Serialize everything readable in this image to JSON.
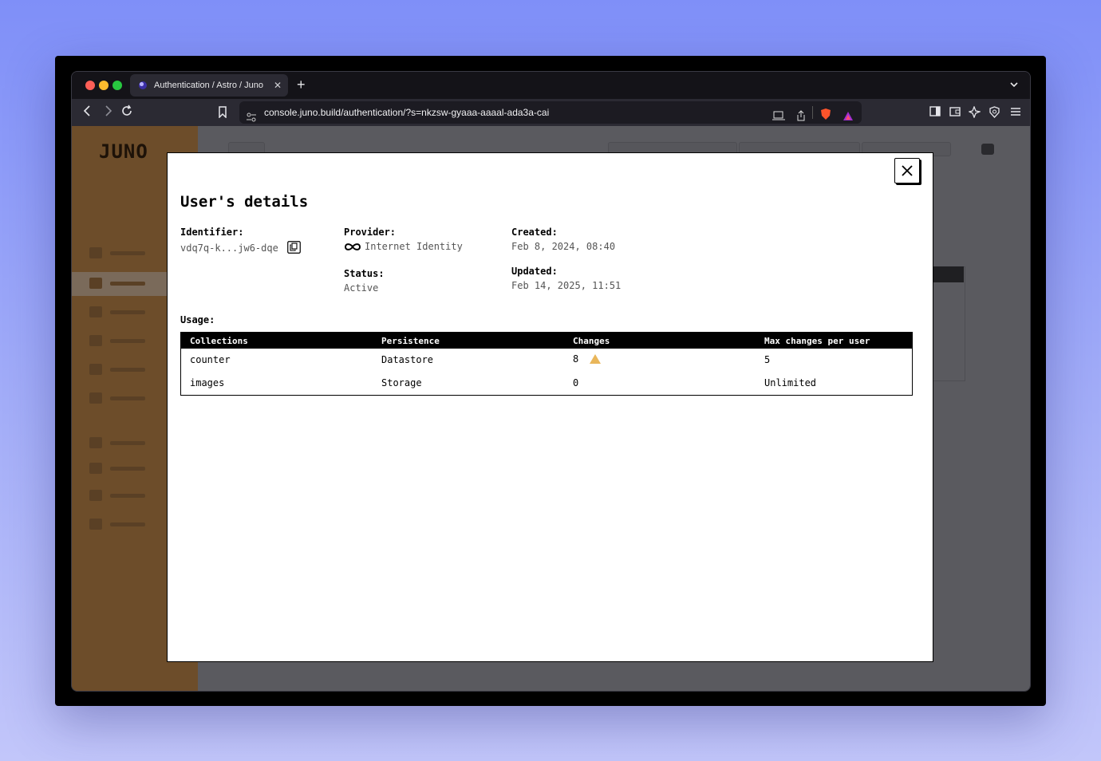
{
  "browser": {
    "tab_title": "Authentication / Astro / Juno",
    "tab_close": "✕",
    "new_tab": "+",
    "url": "console.juno.build/authentication/?s=nkzsw-gyaaa-aaaal-ada3a-cai"
  },
  "background_app": {
    "logo": "JUNO"
  },
  "modal": {
    "title": "User's details",
    "identifier_label": "Identifier:",
    "identifier_value": "vdq7q-k...jw6-dqe",
    "provider_label": "Provider:",
    "provider_value": "Internet Identity",
    "status_label": "Status:",
    "status_value": "Active",
    "created_label": "Created:",
    "created_value": "Feb 8, 2024, 08:40",
    "updated_label": "Updated:",
    "updated_value": "Feb 14, 2025, 11:51",
    "usage_label": "Usage:",
    "table": {
      "headers": [
        "Collections",
        "Persistence",
        "Changes",
        "Max changes per user"
      ],
      "rows": [
        {
          "collection": "counter",
          "persistence": "Datastore",
          "changes": "8",
          "max": "5",
          "warning": true
        },
        {
          "collection": "images",
          "persistence": "Storage",
          "changes": "0",
          "max": "Unlimited",
          "warning": false
        }
      ]
    }
  },
  "colors": {
    "warning": "#e9b65a",
    "sidebar": "#6d4d2a",
    "backdrop": "#5a5a5f"
  },
  "icons": [
    "close-icon",
    "copy-icon",
    "infinity-icon",
    "warning-icon",
    "back-icon",
    "forward-icon",
    "reload-icon",
    "bookmark-icon",
    "brave-shield-icon"
  ]
}
